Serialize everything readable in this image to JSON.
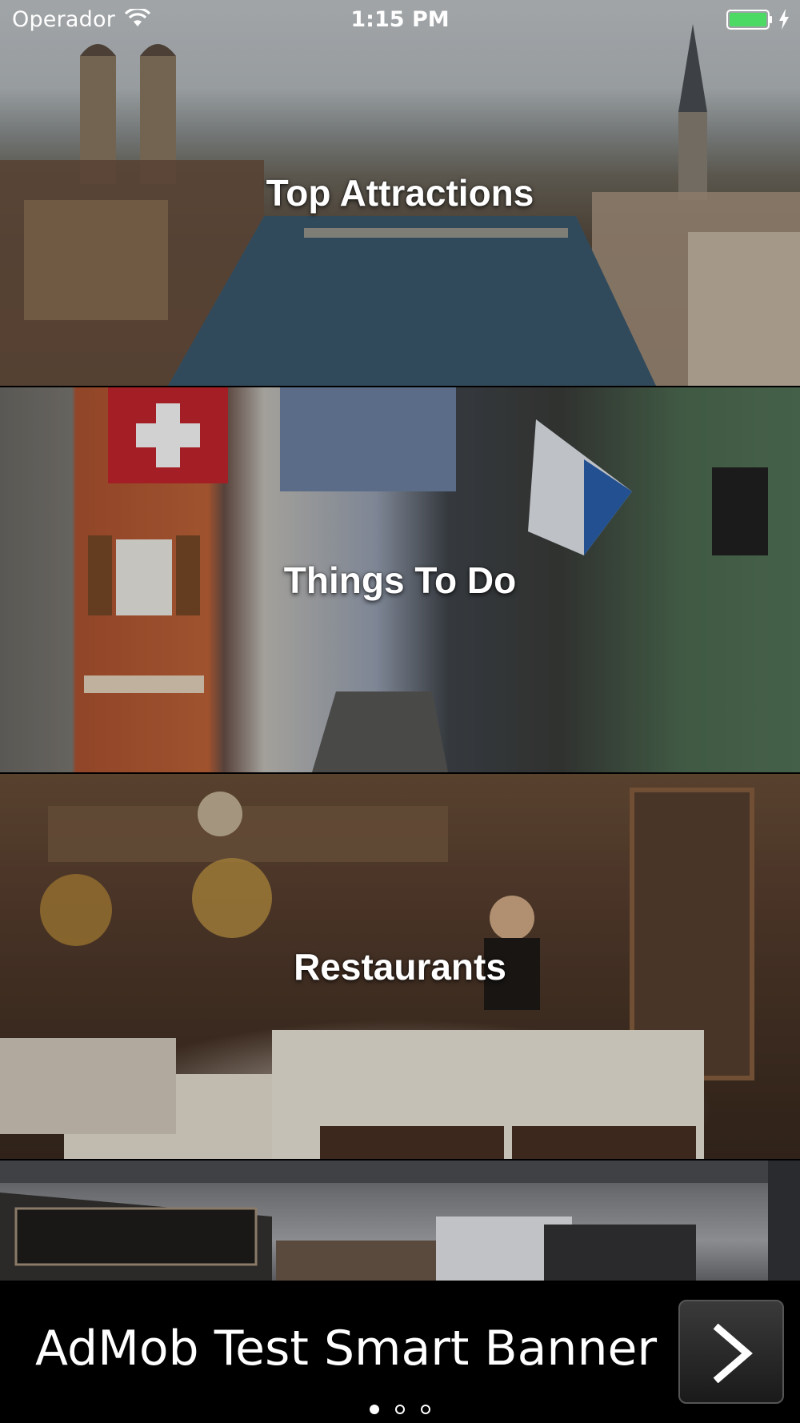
{
  "status_bar": {
    "carrier": "Operador",
    "time": "1:15 PM",
    "wifi_icon": "wifi-icon",
    "battery_icon": "battery-full-icon",
    "battery_color": "#4cd964"
  },
  "categories": [
    {
      "title": "Top Attractions",
      "image": "zurich-river-cityscape"
    },
    {
      "title": "Things To Do",
      "image": "old-town-street-with-flags"
    },
    {
      "title": "Restaurants",
      "image": "restaurant-interior"
    },
    {
      "title": "",
      "image": "dining-room-interior"
    }
  ],
  "ad_banner": {
    "text": "AdMob Test Smart Banner",
    "button_icon": "chevron-right-icon"
  },
  "pager": {
    "total": 3,
    "current": 1
  }
}
